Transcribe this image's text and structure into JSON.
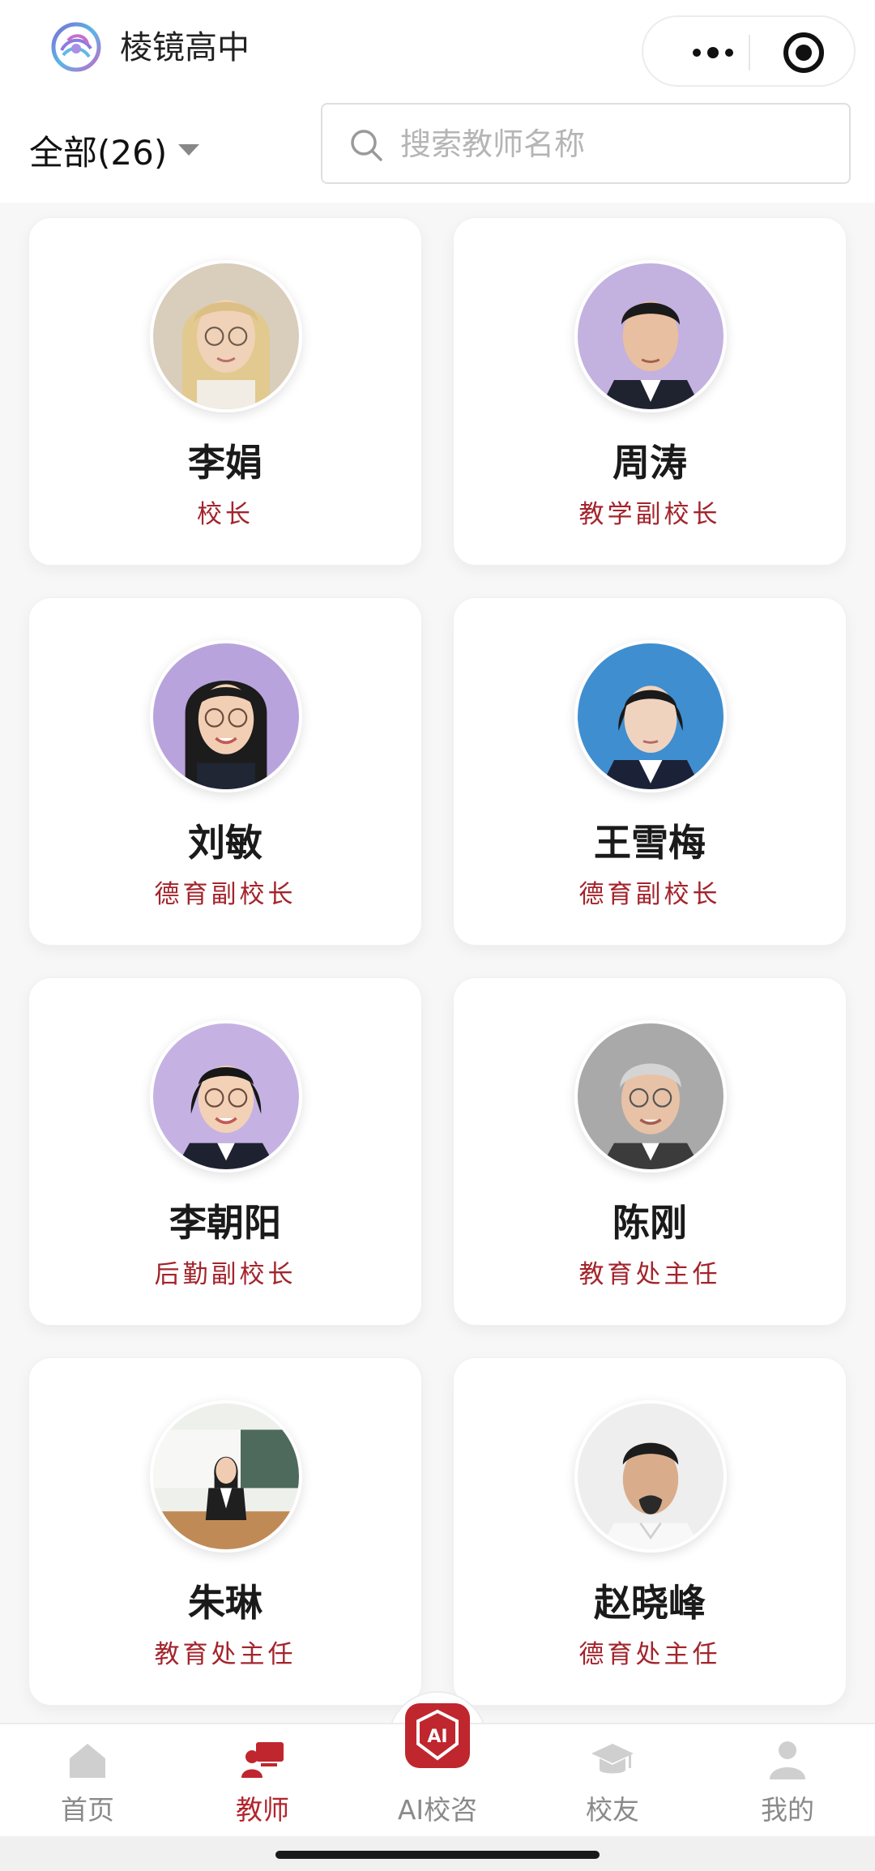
{
  "app": {
    "title": "棱镜高中"
  },
  "filter": {
    "label": "全部(26)"
  },
  "search": {
    "placeholder": "搜索教师名称"
  },
  "teachers": [
    {
      "name": "李娟",
      "role": "校长"
    },
    {
      "name": "周涛",
      "role": "教学副校长"
    },
    {
      "name": "刘敏",
      "role": "德育副校长"
    },
    {
      "name": "王雪梅",
      "role": "德育副校长"
    },
    {
      "name": "李朝阳",
      "role": "后勤副校长"
    },
    {
      "name": "陈刚",
      "role": "教育处主任"
    },
    {
      "name": "朱琳",
      "role": "教育处主任"
    },
    {
      "name": "赵晓峰",
      "role": "德育处主任"
    }
  ],
  "tabbar": {
    "items": [
      {
        "label": "首页",
        "icon": "home-icon",
        "active": false
      },
      {
        "label": "教师",
        "icon": "teacher-icon",
        "active": true
      },
      {
        "label": "AI校咨",
        "icon": "ai-icon",
        "active": false
      },
      {
        "label": "校友",
        "icon": "graduation-cap-icon",
        "active": false
      },
      {
        "label": "我的",
        "icon": "user-icon",
        "active": false
      }
    ],
    "ai_badge_text": "AI"
  },
  "colors": {
    "accent": "#b3252d",
    "role_text": "#a3242c",
    "inactive_tab": "#8a8a8a",
    "background": "#f7f7f7"
  }
}
